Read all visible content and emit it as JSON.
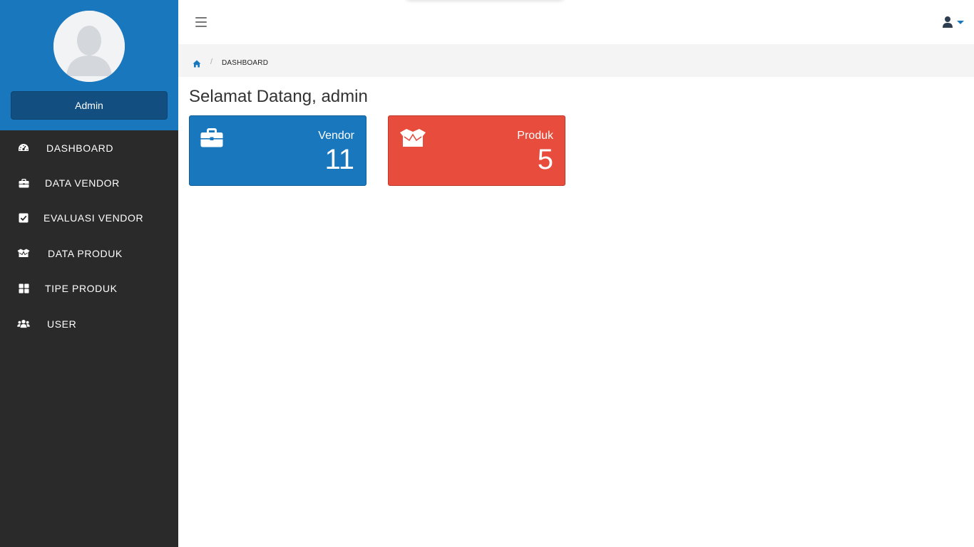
{
  "sidebar": {
    "user_name": "Admin",
    "menu": [
      {
        "label": "DASHBOARD",
        "icon": "tachometer-icon"
      },
      {
        "label": "DATA VENDOR",
        "icon": "briefcase-icon"
      },
      {
        "label": "EVALUASI VENDOR",
        "icon": "check-square-icon"
      },
      {
        "label": "DATA PRODUK",
        "icon": "box-open-icon"
      },
      {
        "label": "TIPE PRODUK",
        "icon": "th-large-icon"
      },
      {
        "label": "USER",
        "icon": "users-icon"
      }
    ]
  },
  "topbar": {
    "menu_toggle_icon": "bars-icon",
    "user_icon": "user-icon"
  },
  "breadcrumb": {
    "home_icon": "home-icon",
    "separator": "/",
    "current": "DASHBOARD"
  },
  "main": {
    "welcome": "Selamat Datang, admin",
    "cards": [
      {
        "title": "Vendor",
        "value": "11",
        "icon": "briefcase-icon",
        "color": "#1877bd"
      },
      {
        "title": "Produk",
        "value": "5",
        "icon": "box-open-icon",
        "color": "#e74c3c"
      }
    ]
  },
  "colors": {
    "primary": "#1877bd",
    "danger": "#e74c3c",
    "sidebar_bg": "#2a2a2a"
  }
}
